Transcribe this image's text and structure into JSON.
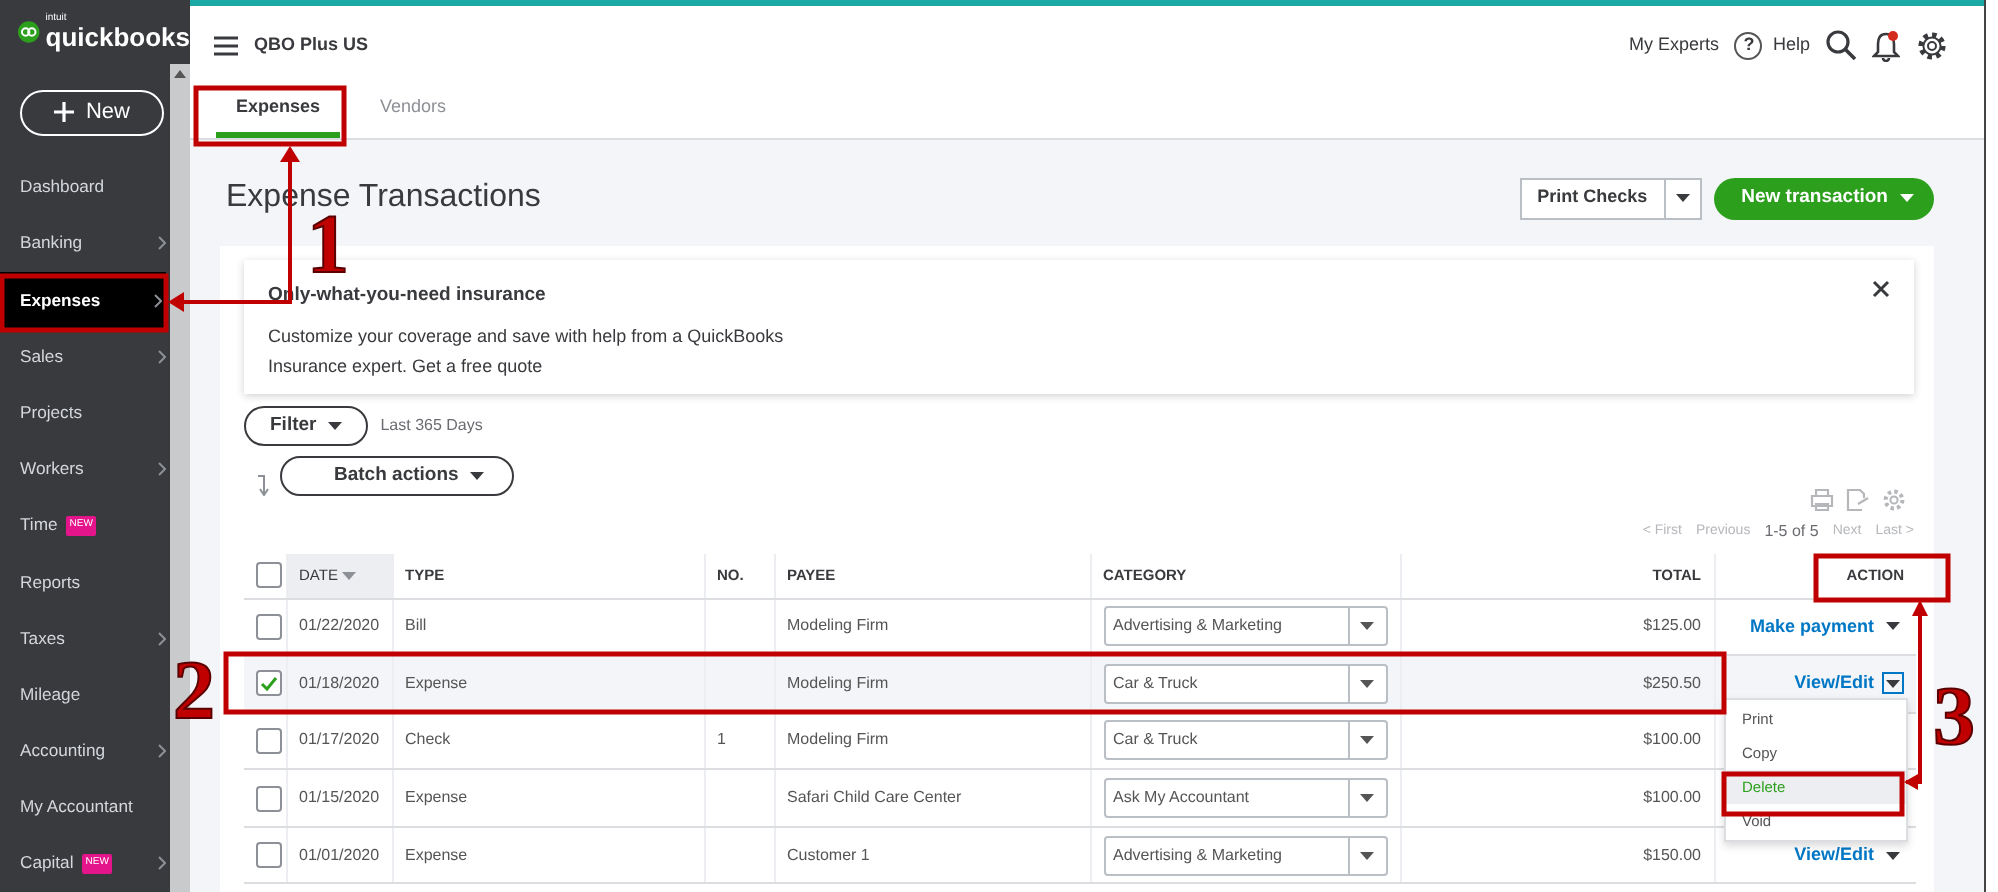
{
  "sidebar": {
    "brand_small": "intuit",
    "brand": "quickbooks",
    "new_button": "New",
    "items": [
      {
        "label": "Dashboard",
        "selected": false,
        "has_submenu": false
      },
      {
        "label": "Banking",
        "selected": false,
        "has_submenu": true
      },
      {
        "label": "Expenses",
        "selected": true,
        "has_submenu": true
      },
      {
        "label": "Sales",
        "selected": false,
        "has_submenu": true
      },
      {
        "label": "Projects",
        "selected": false,
        "has_submenu": false
      },
      {
        "label": "Workers",
        "selected": false,
        "has_submenu": true
      },
      {
        "label": "Time",
        "selected": false,
        "has_submenu": false,
        "badge": "NEW"
      },
      {
        "label": "Reports",
        "selected": false,
        "has_submenu": false
      },
      {
        "label": "Taxes",
        "selected": false,
        "has_submenu": true
      },
      {
        "label": "Mileage",
        "selected": false,
        "has_submenu": false
      },
      {
        "label": "Accounting",
        "selected": false,
        "has_submenu": true
      },
      {
        "label": "My Accountant",
        "selected": false,
        "has_submenu": false
      },
      {
        "label": "Capital",
        "selected": false,
        "has_submenu": true,
        "badge": "NEW"
      }
    ]
  },
  "header": {
    "company": "QBO Plus US",
    "experts": "My Experts",
    "help_icon": "?",
    "help": "Help",
    "has_notification": true
  },
  "tabs": [
    {
      "label": "Expenses",
      "selected": true
    },
    {
      "label": "Vendors",
      "selected": false
    }
  ],
  "page": {
    "title": "Expense Transactions",
    "secondary_button": "Print Checks",
    "primary_button": "New transaction"
  },
  "promo": {
    "title": "Only-what-you-need insurance",
    "text": "Customize your coverage and save with help from a QuickBooks Insurance expert.",
    "link": "Get a free quote"
  },
  "filters": {
    "filter_button": "Filter",
    "range": "Last 365 Days",
    "batch_button": "Batch actions"
  },
  "pagination": {
    "first": "< First",
    "previous": "Previous",
    "range": "1-5 of 5",
    "next": "Next",
    "last": "Last >"
  },
  "table": {
    "columns": [
      {
        "label": "DATE",
        "sorted": true
      },
      {
        "label": "TYPE",
        "sorted": false
      },
      {
        "label": "NO.",
        "sorted": false
      },
      {
        "label": "PAYEE",
        "sorted": false
      },
      {
        "label": "CATEGORY",
        "sorted": false
      },
      {
        "label": "TOTAL",
        "sorted": false
      },
      {
        "label": "ACTION",
        "sorted": false
      }
    ],
    "all_checked": false,
    "rows": [
      {
        "checked": false,
        "date": "01/22/2020",
        "type": "Bill",
        "no": "",
        "payee": "Modeling Firm",
        "category": "Advertising & Marketing",
        "total": "$125.00",
        "action": "Make payment",
        "menu_open": false
      },
      {
        "checked": true,
        "date": "01/18/2020",
        "type": "Expense",
        "no": "",
        "payee": "Modeling Firm",
        "category": "Car & Truck",
        "total": "$250.50",
        "action": "View/Edit",
        "menu_open": true
      },
      {
        "checked": false,
        "date": "01/17/2020",
        "type": "Check",
        "no": "1",
        "payee": "Modeling Firm",
        "category": "Car & Truck",
        "total": "$100.00"
      },
      {
        "checked": false,
        "date": "01/15/2020",
        "type": "Expense",
        "no": "",
        "payee": "Safari Child Care Center",
        "category": "Ask My Accountant",
        "total": "$100.00"
      },
      {
        "checked": false,
        "date": "01/01/2020",
        "type": "Expense",
        "no": "",
        "payee": "Customer 1",
        "category": "Advertising & Marketing",
        "total": "$150.00",
        "action": "View/Edit",
        "menu_open": false
      }
    ]
  },
  "action_menu": {
    "items": [
      {
        "label": "Print",
        "selected": false
      },
      {
        "label": "Copy",
        "selected": false
      },
      {
        "label": "Delete",
        "selected": true
      },
      {
        "label": "Void",
        "selected": false
      }
    ]
  },
  "annotations": [
    {
      "number": "1"
    },
    {
      "number": "2"
    },
    {
      "number": "3"
    }
  ]
}
